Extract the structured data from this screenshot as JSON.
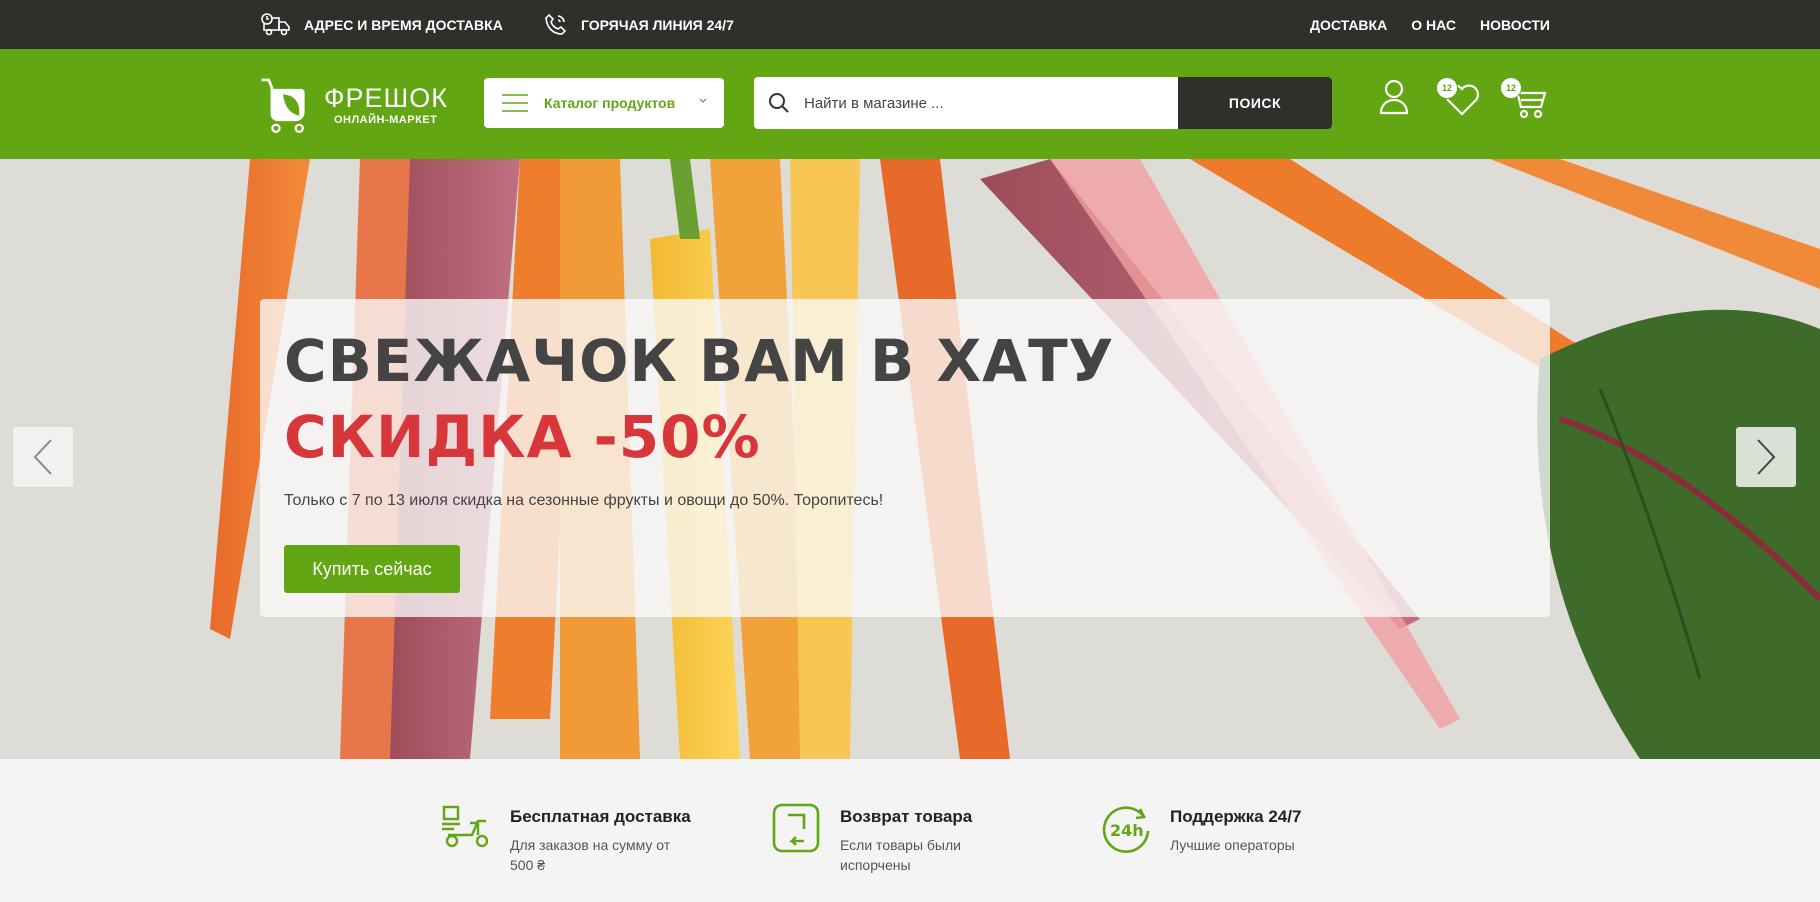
{
  "topbar": {
    "address_label": "АДРЕС И ВРЕМЯ ДОСТАВКА",
    "hotline_label": "ГОРЯЧАЯ ЛИНИЯ 24/7",
    "nav": [
      "ДОСТАВКА",
      "О НАС",
      "НОВОСТИ"
    ]
  },
  "header": {
    "logo_title": "ФРЕШОК",
    "logo_subtitle": "ОНЛАЙН-МАРКЕТ",
    "catalog_label": "Каталог продуктов",
    "search_placeholder": "Найти в магазине ...",
    "search_button": "ПОИСК",
    "wishlist_count": "12",
    "cart_count": "12"
  },
  "hero": {
    "title": "СВЕЖАЧОК ВАМ В ХАТУ",
    "sale": "СКИДКА -50%",
    "description": "Только с 7 по 13 июля скидка на сезонные фрукты и овощи до 50%. Торопитесь!",
    "button": "Купить сейчас"
  },
  "features": [
    {
      "title": "Бесплатная доставка",
      "desc": "Для заказов на сумму от 500 ₴",
      "icon": "scooter-icon"
    },
    {
      "title": "Возврат товара",
      "desc": "Если товары были испорчены",
      "icon": "return-phone-icon"
    },
    {
      "title": "Поддержка 24/7",
      "desc": "Лучшие операторы",
      "icon": "support-24h-icon"
    }
  ],
  "colors": {
    "brand_green": "#62a613",
    "dark": "#2e302c",
    "sale_red": "#d7373a"
  }
}
